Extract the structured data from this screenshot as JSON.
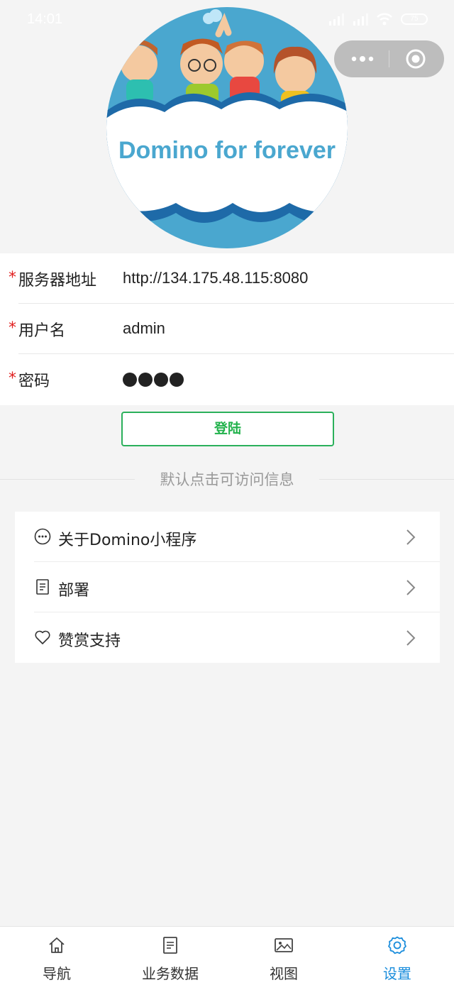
{
  "status_bar": {
    "time": "14:01",
    "battery": "75"
  },
  "logo": {
    "text": "Domino for forever"
  },
  "form": {
    "server": {
      "label": "服务器地址",
      "value": "http://134.175.48.115:8080"
    },
    "username": {
      "label": "用户名",
      "value": "admin"
    },
    "password": {
      "label": "密码"
    },
    "required_mark": "*"
  },
  "login_button": "登陆",
  "hint": "默认点击可访问信息",
  "menu": [
    {
      "label": "关于Domino小程序",
      "icon": "more-circle-icon"
    },
    {
      "label": "部署",
      "icon": "document-icon"
    },
    {
      "label": "赞赏支持",
      "icon": "heart-icon"
    }
  ],
  "tabbar": [
    {
      "label": "导航",
      "icon": "home-icon"
    },
    {
      "label": "业务数据",
      "icon": "document-icon"
    },
    {
      "label": "视图",
      "icon": "image-icon"
    },
    {
      "label": "设置",
      "icon": "settings-gear-icon",
      "active": true
    }
  ],
  "colors": {
    "accent": "#1a8ddc",
    "login_green": "#22b24c",
    "required_red": "#e02020"
  }
}
